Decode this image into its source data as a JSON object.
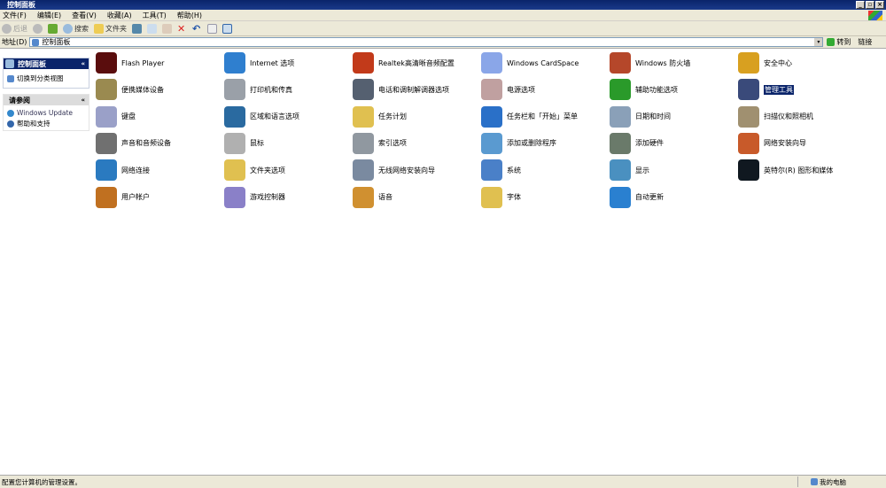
{
  "window": {
    "title": "控制面板",
    "controls": [
      "_",
      "▫",
      "×"
    ]
  },
  "menu": [
    "文件(F)",
    "编辑(E)",
    "查看(V)",
    "收藏(A)",
    "工具(T)",
    "帮助(H)"
  ],
  "toolbar": {
    "back": "后退",
    "search": "搜索",
    "folders": "文件夹"
  },
  "address": {
    "label": "地址(D)",
    "value": "控制面板",
    "go": "转到",
    "links": "链接"
  },
  "sidebar": {
    "panel1": {
      "title": "控制面板",
      "items": [
        "切换到分类视图"
      ]
    },
    "panel2": {
      "title": "请参阅",
      "items": [
        "Windows Update",
        "帮助和支持"
      ]
    }
  },
  "items": [
    {
      "label": "Flash Player",
      "icon": "flash-icon",
      "color": "#5a0d0d"
    },
    {
      "label": "Internet 选项",
      "icon": "globe-icon",
      "color": "#2f7fcf"
    },
    {
      "label": "Realtek高清晰音频配置",
      "icon": "speaker-icon",
      "color": "#c23a1a"
    },
    {
      "label": "Windows CardSpace",
      "icon": "cardspace-icon",
      "color": "#8aa6e8"
    },
    {
      "label": "Windows 防火墙",
      "icon": "firewall-icon",
      "color": "#b5472a"
    },
    {
      "label": "安全中心",
      "icon": "shield-icon",
      "color": "#d8a020"
    },
    {
      "label": "便携媒体设备",
      "icon": "media-device-icon",
      "color": "#9a8a50"
    },
    {
      "label": "打印机和传真",
      "icon": "printer-icon",
      "color": "#9aa0a8"
    },
    {
      "label": "电话和调制解调器选项",
      "icon": "phone-icon",
      "color": "#556070"
    },
    {
      "label": "电源选项",
      "icon": "power-icon",
      "color": "#c0a0a0"
    },
    {
      "label": "辅助功能选项",
      "icon": "accessibility-icon",
      "color": "#2a9a2a"
    },
    {
      "label": "管理工具",
      "icon": "admin-tools-icon",
      "color": "#3a4a7a",
      "selected": true
    },
    {
      "label": "键盘",
      "icon": "keyboard-icon",
      "color": "#9aa0c8"
    },
    {
      "label": "区域和语言选项",
      "icon": "globe-icon",
      "color": "#2a6aa0"
    },
    {
      "label": "任务计划",
      "icon": "scheduled-tasks-icon",
      "color": "#e0c050"
    },
    {
      "label": "任务栏和「开始」菜单",
      "icon": "taskbar-icon",
      "color": "#2a70c8"
    },
    {
      "label": "日期和时间",
      "icon": "clock-icon",
      "color": "#8aa0b8"
    },
    {
      "label": "扫描仪和照相机",
      "icon": "scanner-icon",
      "color": "#a09070"
    },
    {
      "label": "声音和音频设备",
      "icon": "sound-icon",
      "color": "#707070"
    },
    {
      "label": "鼠标",
      "icon": "mouse-icon",
      "color": "#b0b0b0"
    },
    {
      "label": "索引选项",
      "icon": "search-index-icon",
      "color": "#9098a0"
    },
    {
      "label": "添加或删除程序",
      "icon": "add-remove-icon",
      "color": "#5a9ad0"
    },
    {
      "label": "添加硬件",
      "icon": "hardware-icon",
      "color": "#6a7a6a"
    },
    {
      "label": "网络安装向导",
      "icon": "home-network-icon",
      "color": "#c85a2a"
    },
    {
      "label": "网络连接",
      "icon": "network-icon",
      "color": "#2a7ac0"
    },
    {
      "label": "文件夹选项",
      "icon": "folder-icon",
      "color": "#e0c050"
    },
    {
      "label": "无线网络安装向导",
      "icon": "wireless-icon",
      "color": "#7a8aa0"
    },
    {
      "label": "系统",
      "icon": "system-icon",
      "color": "#4a80c8"
    },
    {
      "label": "显示",
      "icon": "display-icon",
      "color": "#4a90c0"
    },
    {
      "label": "英特尔(R) 图形和媒体",
      "icon": "intel-graphics-icon",
      "color": "#101820"
    },
    {
      "label": "用户帐户",
      "icon": "users-icon",
      "color": "#c07020"
    },
    {
      "label": "游戏控制器",
      "icon": "gamepad-icon",
      "color": "#8a80c8"
    },
    {
      "label": "语音",
      "icon": "speech-icon",
      "color": "#d09030"
    },
    {
      "label": "字体",
      "icon": "fonts-icon",
      "color": "#e0c050"
    },
    {
      "label": "自动更新",
      "icon": "windows-update-icon",
      "color": "#2a80d0"
    }
  ],
  "status": {
    "text": "配置您计算机的管理设置。",
    "zone": "我的电脑"
  }
}
